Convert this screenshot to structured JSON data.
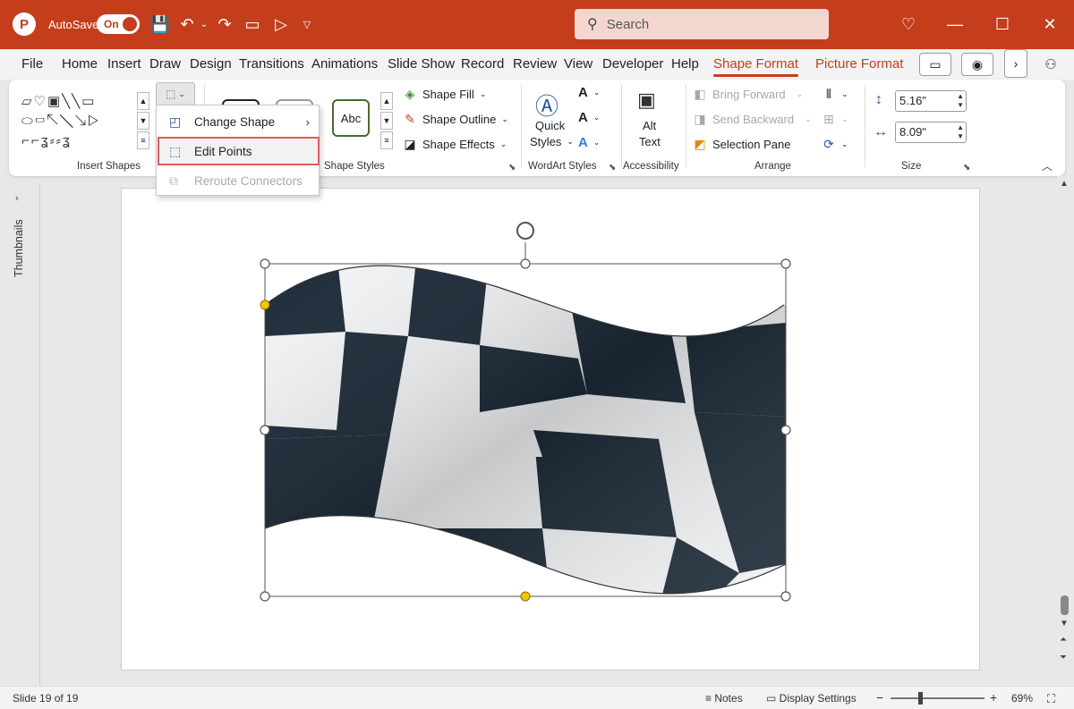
{
  "titlebar": {
    "app_logo": "P",
    "autosave_label": "AutoSave",
    "autosave_state": "On",
    "search_placeholder": "Search"
  },
  "tabs": [
    "File",
    "Home",
    "Insert",
    "Draw",
    "Design",
    "Transitions",
    "Animations",
    "Slide Show",
    "Record",
    "Review",
    "View",
    "Developer",
    "Help",
    "Shape Format",
    "Picture Format"
  ],
  "active_tab": "Shape Format",
  "ribbon": {
    "insert_shapes_label": "Insert Shapes",
    "shape_styles_label": "Shape Styles",
    "abc_label": "Abc",
    "shape_fill": "Shape Fill",
    "shape_outline": "Shape Outline",
    "shape_effects": "Shape Effects",
    "quick_styles_1": "Quick",
    "quick_styles_2": "Styles",
    "wordart_label": "WordArt Styles",
    "alt_text_1": "Alt",
    "alt_text_2": "Text",
    "accessibility_label": "Accessibility",
    "bring_forward": "Bring Forward",
    "send_backward": "Send Backward",
    "selection_pane": "Selection Pane",
    "arrange_label": "Arrange",
    "height_value": "5.16\"",
    "width_value": "8.09\"",
    "size_label": "Size"
  },
  "menu": {
    "change_shape": "Change Shape",
    "edit_points": "Edit Points",
    "reroute_connectors": "Reroute Connectors"
  },
  "sidebar": {
    "thumbnails_label": "Thumbnails"
  },
  "statusbar": {
    "slide_info": "Slide 19 of 19",
    "notes": "Notes",
    "display_settings": "Display Settings",
    "zoom_minus": "−",
    "zoom_plus": "+",
    "zoom_level": "69%"
  },
  "colors": {
    "accent": "#c43e1c",
    "highlight": "#e35d5b",
    "handle_yellow": "#f5c400"
  }
}
